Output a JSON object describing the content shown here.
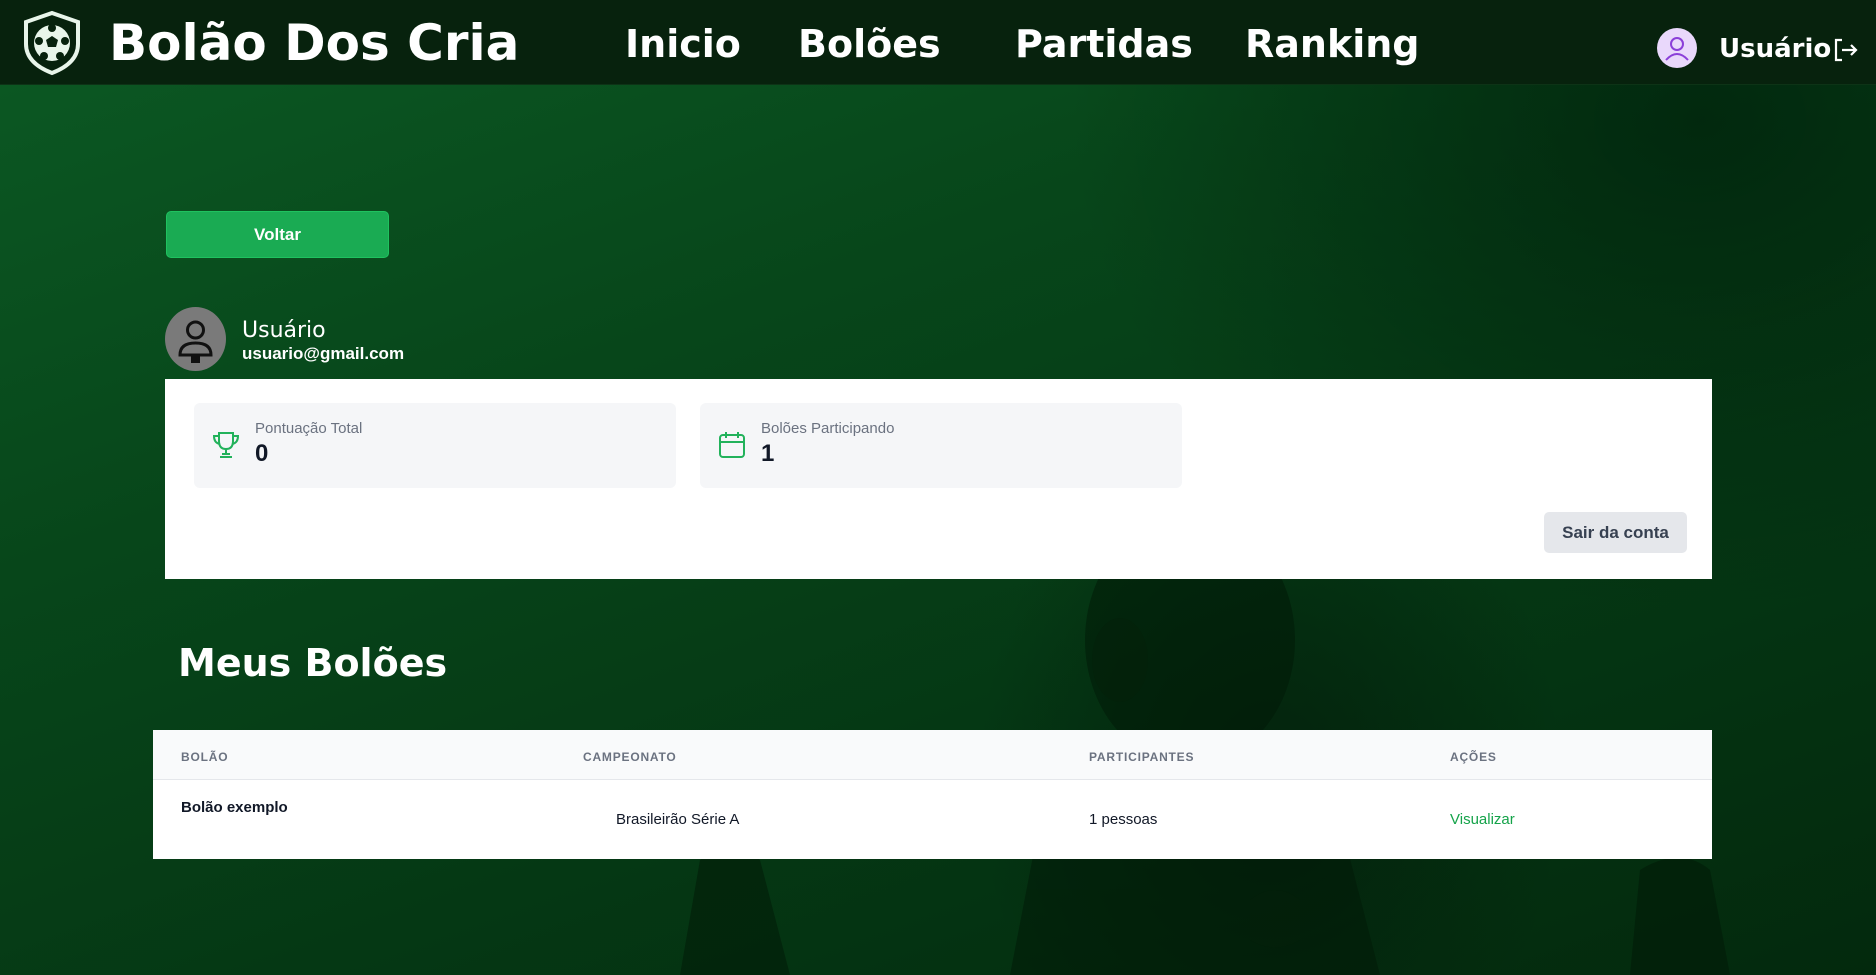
{
  "app": {
    "brand": "Bolão Dos Cria",
    "nav": [
      {
        "label": "Inicio"
      },
      {
        "label": "Bolões"
      },
      {
        "label": "Partidas"
      },
      {
        "label": "Ranking"
      }
    ],
    "user_label": "Usuário"
  },
  "page": {
    "back_label": "Voltar",
    "profile": {
      "name": "Usuário",
      "email": "usuario@gmail.com"
    },
    "stats": [
      {
        "label": "Pontuação Total",
        "value": "0",
        "icon": "trophy-icon"
      },
      {
        "label": "Bolões Participando",
        "value": "1",
        "icon": "calendar-icon"
      }
    ],
    "logout_label": "Sair da conta",
    "section_title": "Meus Bolões",
    "table": {
      "headers": [
        "BOLÃO",
        "CAMPEONATO",
        "PARTICIPANTES",
        "AÇÕES"
      ],
      "rows": [
        {
          "bolao": "Bolão exemplo",
          "campeonato": "Brasileirão Série A",
          "participantes": "1 pessoas",
          "acao": "Visualizar"
        }
      ]
    }
  },
  "colors": {
    "accent": "#1aab53",
    "topbar": "#07220d",
    "background": "#0a4a1c"
  }
}
